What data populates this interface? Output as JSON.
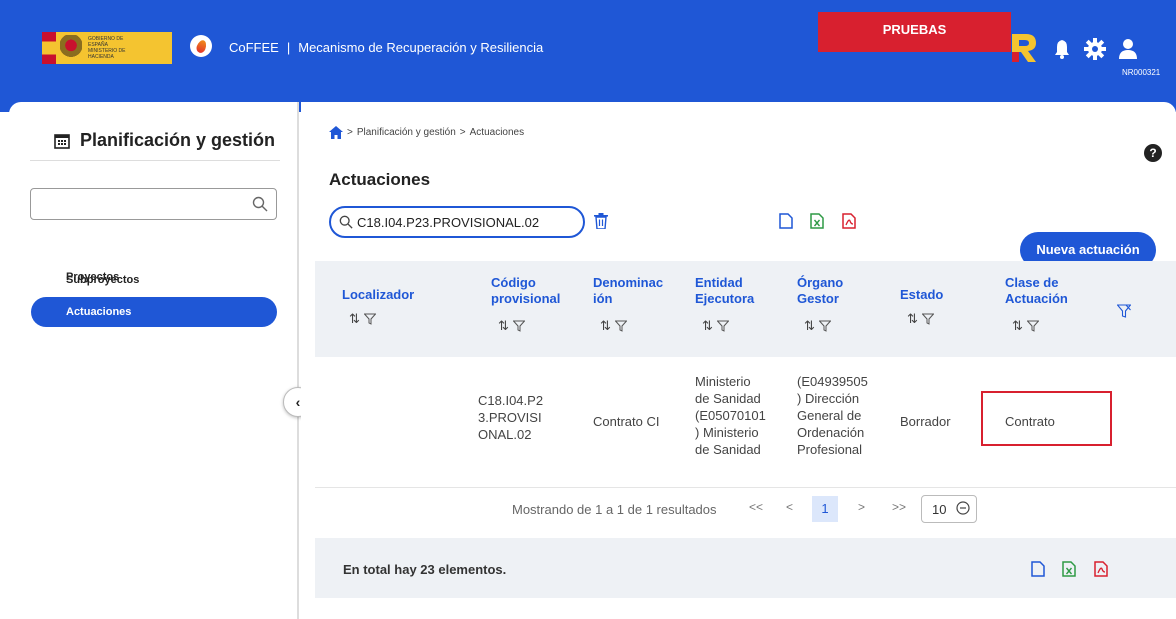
{
  "header": {
    "app_name": "CoFFEE",
    "separator": "|",
    "subtitle": "Mecanismo de Recuperación y Resiliencia",
    "gov_logo_text": "GOBIERNO DE ESPAÑA MINISTERIO DE HACIENDA",
    "environment": "PRUEBAS",
    "user_code": "NR000321",
    "brand_color": "#1f57d6",
    "badge_color": "#d8202f"
  },
  "sidebar": {
    "title": "Planificación y gestión",
    "search_placeholder": "",
    "items": [
      {
        "label": "Proyectos",
        "active": false
      },
      {
        "label": "Subproyectos",
        "active": false
      },
      {
        "label": "Actuaciones",
        "active": true
      }
    ],
    "collapse_glyph": "‹"
  },
  "breadcrumb": {
    "items": [
      "Planificación y gestión",
      "Actuaciones"
    ],
    "separator": ">"
  },
  "help_glyph": "?",
  "page": {
    "title": "Actuaciones",
    "search_value": "C18.I04.P23.PROVISIONAL.02",
    "new_button": "Nueva actuación"
  },
  "table": {
    "sort_glyph": "⇅",
    "columns": [
      {
        "key": "localizador",
        "label": "Localizador"
      },
      {
        "key": "codigo",
        "label": "Código provisional"
      },
      {
        "key": "denominacion",
        "label": "Denominación"
      },
      {
        "key": "entidad",
        "label": "Entidad Ejecutora"
      },
      {
        "key": "organo",
        "label": "Órgano Gestor"
      },
      {
        "key": "estado",
        "label": "Estado"
      },
      {
        "key": "clase",
        "label": "Clase de Actuación"
      }
    ],
    "header_lines": {
      "localizador": [
        "Localizador"
      ],
      "codigo": [
        "Código",
        "provisional"
      ],
      "denominacion": [
        "Denominac",
        "ión"
      ],
      "entidad": [
        "Entidad",
        "Ejecutora"
      ],
      "organo": [
        "Órgano",
        "Gestor"
      ],
      "estado": [
        "Estado"
      ],
      "clase": [
        "Clase de",
        "Actuación"
      ]
    },
    "rows": [
      {
        "localizador": "",
        "codigo": [
          "C18.I04.P2",
          "3.PROVISI",
          "ONAL.02"
        ],
        "denominacion": [
          "Contrato CI"
        ],
        "entidad": [
          "Ministerio",
          "de Sanidad",
          "(E05070101",
          ") Ministerio",
          "de Sanidad"
        ],
        "organo": [
          "(E04939505",
          ") Dirección",
          "General de",
          "Ordenación",
          "Profesional"
        ],
        "estado": [
          "Borrador"
        ],
        "clase": [
          "Contrato"
        ]
      }
    ]
  },
  "pagination": {
    "summary": "Mostrando de 1 a 1 de 1 resultados",
    "first": "<<",
    "prev": "<",
    "current": "1",
    "next": ">",
    "last": ">>",
    "page_size": "10"
  },
  "footer": {
    "total_text": "En total hay 23 elementos."
  }
}
